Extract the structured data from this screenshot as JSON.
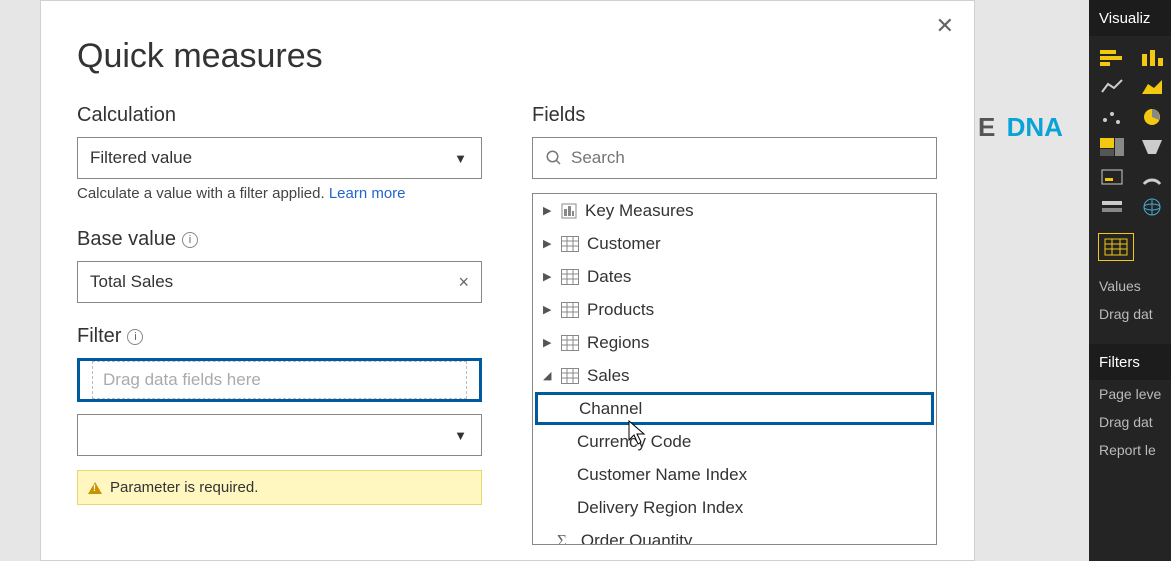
{
  "dialog": {
    "title": "Quick measures",
    "calculation": {
      "label": "Calculation",
      "value": "Filtered value",
      "helper_text": "Calculate a value with a filter applied.",
      "learn_more": "Learn more"
    },
    "base_value": {
      "label": "Base value",
      "value": "Total Sales"
    },
    "filter": {
      "label": "Filter",
      "placeholder": "Drag data fields here",
      "warning": "Parameter is required."
    }
  },
  "fields_panel": {
    "label": "Fields",
    "search_placeholder": "Search",
    "tree": [
      {
        "name": "Key Measures",
        "kind": "measure-group",
        "expanded": false
      },
      {
        "name": "Customer",
        "kind": "table",
        "expanded": false
      },
      {
        "name": "Dates",
        "kind": "table",
        "expanded": false
      },
      {
        "name": "Products",
        "kind": "table",
        "expanded": false
      },
      {
        "name": "Regions",
        "kind": "table",
        "expanded": false
      },
      {
        "name": "Sales",
        "kind": "table",
        "expanded": true,
        "children": [
          {
            "name": "Channel",
            "kind": "column",
            "highlight": true
          },
          {
            "name": "Currency Code",
            "kind": "column"
          },
          {
            "name": "Customer Name Index",
            "kind": "column"
          },
          {
            "name": "Delivery Region Index",
            "kind": "column"
          },
          {
            "name": "Order Quantity",
            "kind": "numeric-column"
          }
        ]
      }
    ]
  },
  "right_panels": {
    "visualizations_header": "Visualiz",
    "values_label": "Values",
    "drag_data_label": "Drag dat",
    "filters_header": "Filters",
    "page_level_label": "Page leve",
    "drag_data_label2": "Drag dat",
    "report_level_label": "Report le"
  },
  "brand_peek": {
    "suffix_e": "E",
    "dna": "DNA"
  }
}
